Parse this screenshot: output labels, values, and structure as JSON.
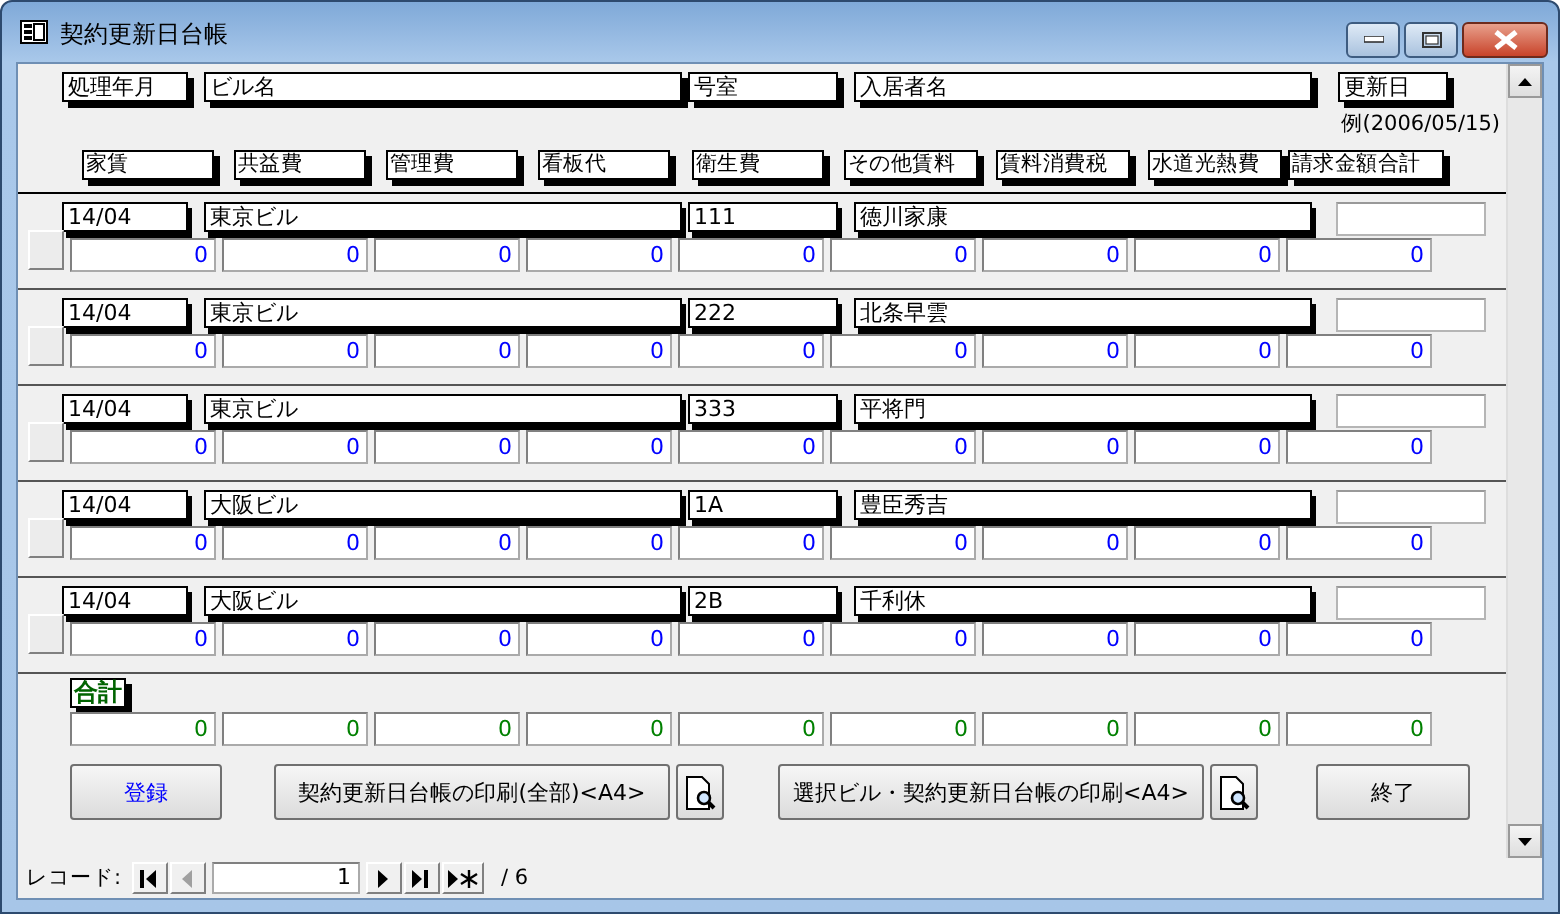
{
  "window": {
    "title": "契約更新日台帳"
  },
  "header_labels": [
    "処理年月",
    "ビル名",
    "号室",
    "入居者名",
    "更新日"
  ],
  "date_hint": "例(2006/05/15)",
  "amount_labels": [
    "家賃",
    "共益費",
    "管理費",
    "看板代",
    "衛生費",
    "その他賃料",
    "賃料消費税",
    "水道光熱費",
    "請求金額合計"
  ],
  "records": [
    {
      "month": "14/04",
      "building": "東京ビル",
      "room": "111",
      "tenant": "徳川家康",
      "amounts": [
        "0",
        "0",
        "0",
        "0",
        "0",
        "0",
        "0",
        "0",
        "0"
      ]
    },
    {
      "month": "14/04",
      "building": "東京ビル",
      "room": "222",
      "tenant": "北条早雲",
      "amounts": [
        "0",
        "0",
        "0",
        "0",
        "0",
        "0",
        "0",
        "0",
        "0"
      ]
    },
    {
      "month": "14/04",
      "building": "東京ビル",
      "room": "333",
      "tenant": "平将門",
      "amounts": [
        "0",
        "0",
        "0",
        "0",
        "0",
        "0",
        "0",
        "0",
        "0"
      ]
    },
    {
      "month": "14/04",
      "building": "大阪ビル",
      "room": "1A",
      "tenant": "豊臣秀吉",
      "amounts": [
        "0",
        "0",
        "0",
        "0",
        "0",
        "0",
        "0",
        "0",
        "0"
      ]
    },
    {
      "month": "14/04",
      "building": "大阪ビル",
      "room": "2B",
      "tenant": "千利休",
      "amounts": [
        "0",
        "0",
        "0",
        "0",
        "0",
        "0",
        "0",
        "0",
        "0"
      ]
    }
  ],
  "total": {
    "label": "合計",
    "amounts": [
      "0",
      "0",
      "0",
      "0",
      "0",
      "0",
      "0",
      "0",
      "0"
    ]
  },
  "buttons": [
    {
      "kind": "text",
      "label": "登録",
      "emphasis": true
    },
    {
      "kind": "text",
      "label": "契約更新日台帳の印刷(全部)<A4>",
      "emphasis": false
    },
    {
      "kind": "preview"
    },
    {
      "kind": "text",
      "label": "選択ビル・契約更新日台帳の印刷<A4>",
      "emphasis": false
    },
    {
      "kind": "preview"
    },
    {
      "kind": "text",
      "label": "終了",
      "emphasis": false
    }
  ],
  "navigation": {
    "label": "レコード:",
    "current": "1",
    "total": "/ 6",
    "buttons": [
      {
        "kind": "first",
        "disabled": false
      },
      {
        "kind": "prev",
        "disabled": true
      },
      {
        "kind": "next",
        "disabled": false
      },
      {
        "kind": "last",
        "disabled": false
      },
      {
        "kind": "new",
        "disabled": false
      }
    ]
  }
}
